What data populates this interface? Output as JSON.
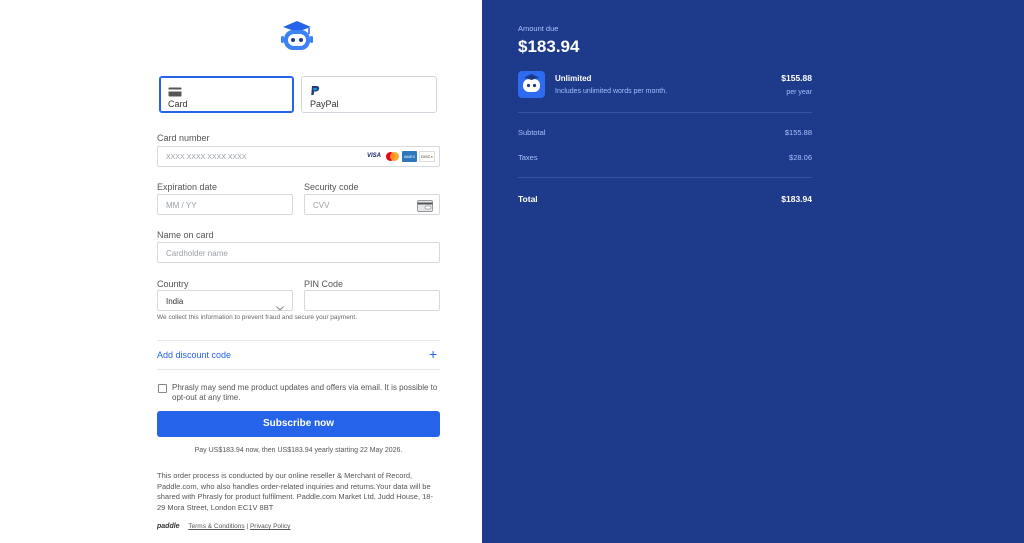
{
  "payment_methods": [
    {
      "label": "Card",
      "icon": "card-icon",
      "selected": true
    },
    {
      "label": "PayPal",
      "icon": "paypal-icon",
      "selected": false
    }
  ],
  "form": {
    "card_number": {
      "label": "Card number",
      "placeholder": "XXXX XXXX XXXX XXXX",
      "brands": [
        "VISA",
        "mastercard",
        "amex",
        "discover"
      ]
    },
    "expiration": {
      "label": "Expiration date",
      "placeholder": "MM / YY"
    },
    "security": {
      "label": "Security code",
      "placeholder": "CVV"
    },
    "name": {
      "label": "Name on card",
      "placeholder": "Cardholder name"
    },
    "country": {
      "label": "Country",
      "value": "India"
    },
    "pin": {
      "label": "PIN Code",
      "value": ""
    },
    "fraud_note": "We collect this information to prevent fraud and secure your payment."
  },
  "discount": {
    "label": "Add discount code",
    "icon": "plus-icon"
  },
  "consent": {
    "text": "Phrasly may send me product updates and offers via email. It is possible to opt-out at any time.",
    "checked": false
  },
  "subscribe": {
    "label": "Subscribe now"
  },
  "pay_note": "Pay US$183.94 now, then US$183.94 yearly starting 22 May 2026.",
  "legal": "This order process is conducted by our online reseller & Merchant of Record, Paddle.com, who also handles order-related inquiries and returns.Your data will be shared with Phrasly for product fulfilment. Paddle.com Market Ltd, Judd House, 18-29 Mora Street, London EC1V 8BT",
  "footer": {
    "brand": "paddle",
    "terms": "Terms & Conditions",
    "separator": "|",
    "privacy": "Privacy Policy"
  },
  "summary": {
    "amount_label": "Amount due",
    "amount": "$183.94",
    "product": {
      "name": "Unlimited",
      "description": "Includes unlimited words per month.",
      "price": "$155.88",
      "period": "per year"
    },
    "subtotal": {
      "label": "Subtotal",
      "value": "$155.88"
    },
    "taxes": {
      "label": "Taxes",
      "value": "$28.06"
    },
    "total": {
      "label": "Total",
      "value": "$183.94"
    }
  },
  "colors": {
    "accent": "#2563eb",
    "panel": "#1e3a8a"
  }
}
